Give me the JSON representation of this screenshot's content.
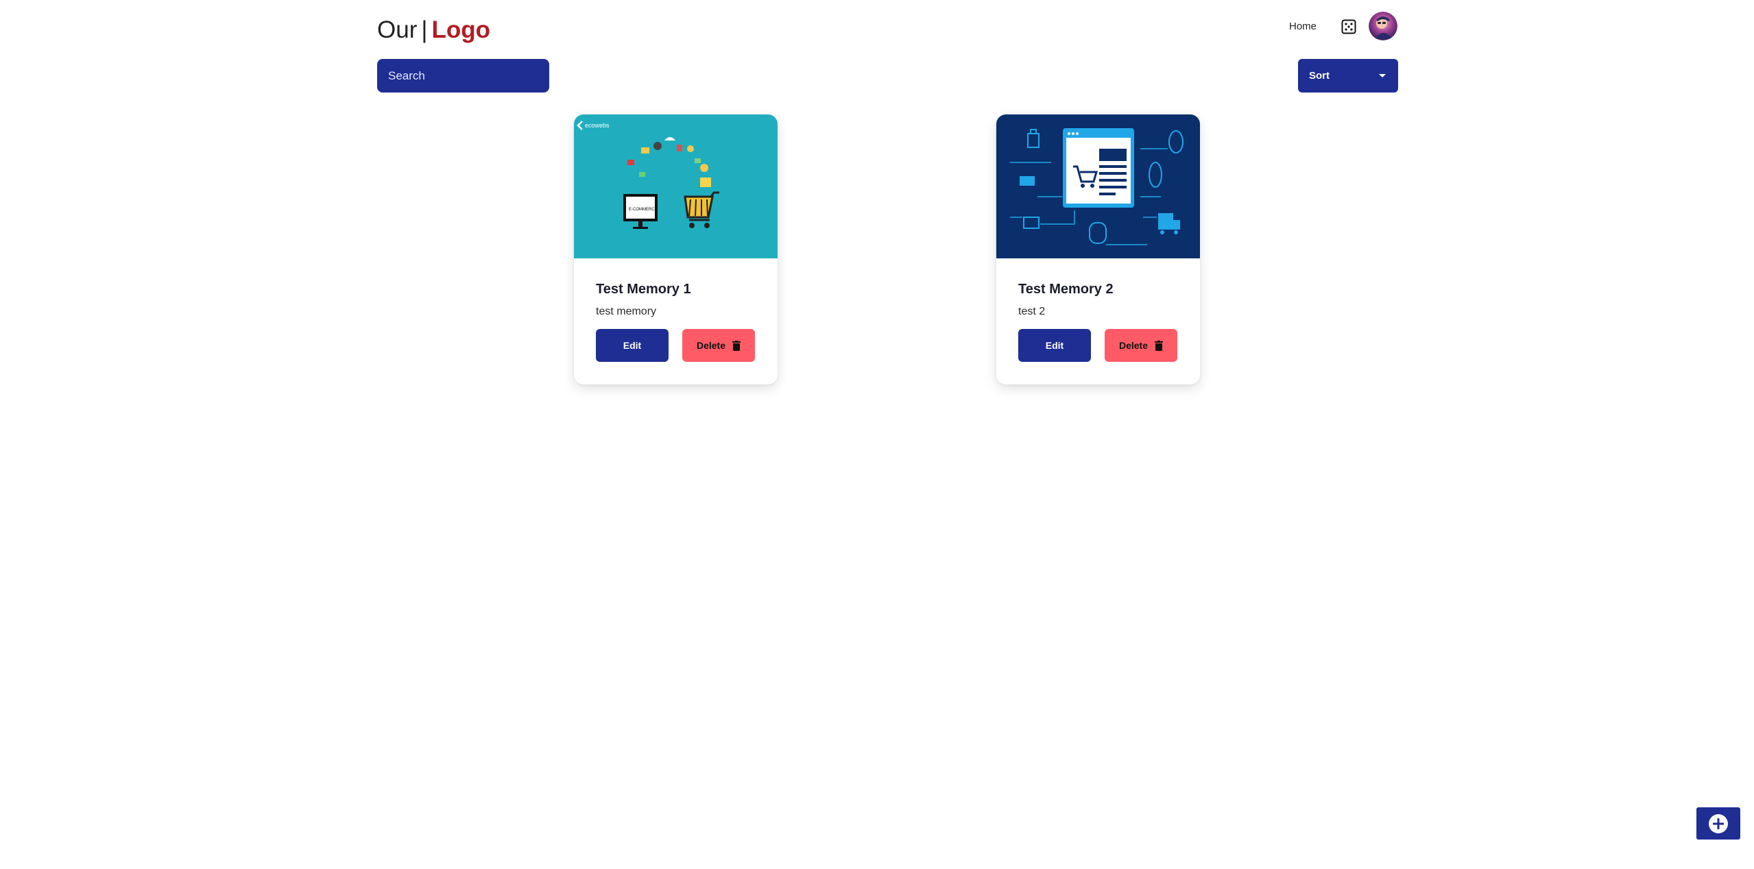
{
  "header": {
    "logo_prefix": "Our",
    "logo_separator": "|",
    "logo_brand": "Logo",
    "nav_home": "Home",
    "grid_icon": "grid-icon",
    "avatar_icon": "user-avatar"
  },
  "toolbar": {
    "search_placeholder": "Search",
    "sort_label": "Sort"
  },
  "cards": [
    {
      "title": "Test Memory 1",
      "description": "test memory",
      "image_text": "ecowebs",
      "edit_label": "Edit",
      "delete_label": "Delete"
    },
    {
      "title": "Test Memory 2",
      "description": "test 2",
      "edit_label": "Edit",
      "delete_label": "Delete"
    }
  ],
  "fab": {
    "icon": "plus-circle-icon"
  },
  "colors": {
    "primary": "#1f2e93",
    "brand": "#b11c23",
    "danger": "#ff5b66",
    "card1_bg": "#20aebf",
    "card2_bg": "#0a2f6b"
  }
}
